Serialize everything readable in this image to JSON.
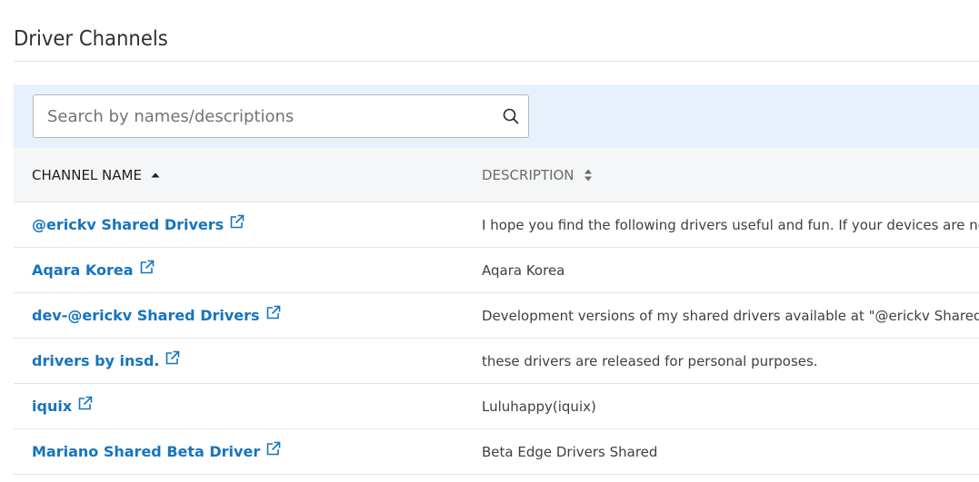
{
  "page": {
    "title": "Driver Channels"
  },
  "search": {
    "placeholder": "Search by names/descriptions",
    "value": "",
    "icon": "search-icon"
  },
  "table": {
    "columns": [
      {
        "label": "CHANNEL NAME",
        "sort": "ascending",
        "sort_icon": "sort-ascending-icon"
      },
      {
        "label": "DESCRIPTION",
        "sort": "none",
        "sort_icon": "sort-both-icon"
      }
    ],
    "rows": [
      {
        "name": "@erickv Shared Drivers",
        "description": "I hope you find the following drivers useful and fun. If your devices are not supported"
      },
      {
        "name": "Aqara Korea",
        "description": "Aqara Korea"
      },
      {
        "name": "dev-@erickv Shared Drivers",
        "description": "Development versions of my shared drivers available at \"@erickv Shared Drivers\""
      },
      {
        "name": "drivers by insd.",
        "description": "these drivers are released for personal purposes."
      },
      {
        "name": "iquix",
        "description": "Luluhappy(iquix)"
      },
      {
        "name": "Mariano Shared Beta Driver",
        "description": "Beta Edge Drivers Shared"
      }
    ]
  },
  "colors": {
    "link": "#1674bf",
    "header_bg": "#f5f6f7",
    "search_area_bg": "#e6f1fb"
  }
}
